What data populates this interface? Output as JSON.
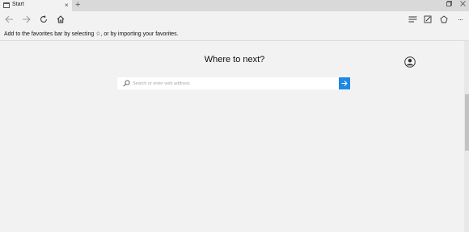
{
  "tab": {
    "title": "Start",
    "close": "×",
    "new_tab": "+"
  },
  "window": {
    "restore": "ᐩ",
    "close": "✕"
  },
  "nav": {
    "back_icon": "back-arrow-icon",
    "forward_icon": "forward-arrow-icon",
    "refresh_icon": "refresh-icon",
    "home_icon": "home-icon",
    "hub_icon": "hub-icon",
    "note_icon": "web-note-icon",
    "share_icon": "share-icon",
    "more_label": "···"
  },
  "favbar": {
    "text": "Add to the favorites bar by selecting ☆, or by importing your favorites."
  },
  "main": {
    "heading": "Where to next?",
    "search_placeholder": "Search or enter web address"
  },
  "colors": {
    "accent": "#1e88e5",
    "background": "#f2f2f2",
    "tabstrip": "#d9d9d9"
  }
}
